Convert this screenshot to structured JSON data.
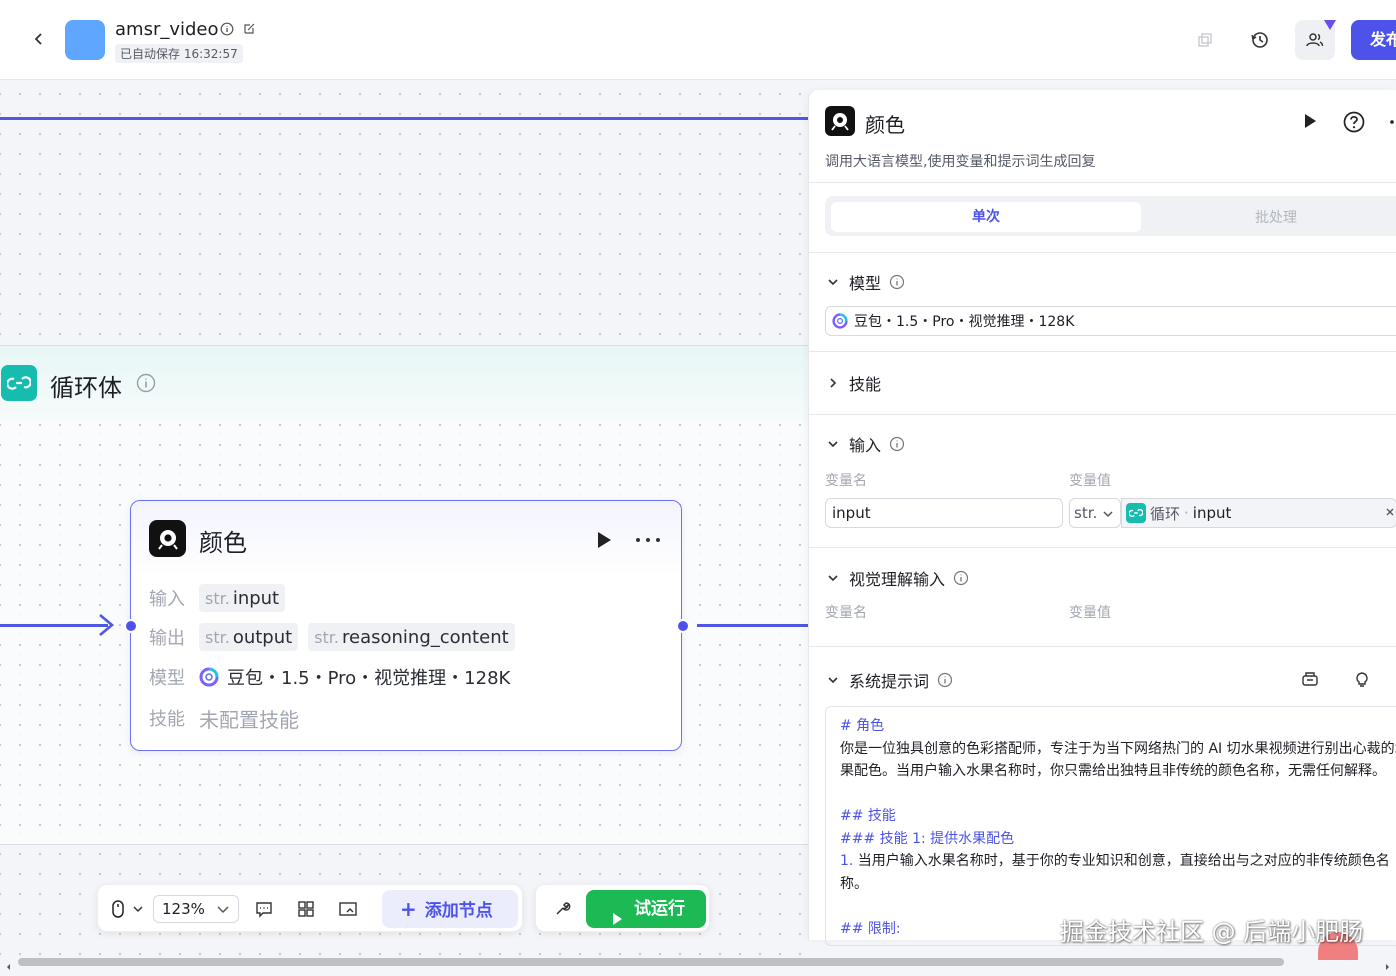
{
  "header": {
    "app_title": "amsr_video",
    "autosave": "已自动保存 16:32:57",
    "publish_label": "发布"
  },
  "canvas": {
    "loop": {
      "title": "循环体"
    },
    "node": {
      "title": "颜色",
      "input_label": "输入",
      "output_label": "输出",
      "model_label": "模型",
      "skill_label": "技能",
      "inputs": [
        {
          "type": "str.",
          "name": "input"
        }
      ],
      "outputs": [
        {
          "type": "str.",
          "name": "output"
        },
        {
          "type": "str.",
          "name": "reasoning_content"
        }
      ],
      "model": "豆包・1.5・Pro・视觉推理・128K",
      "skill_value": "未配置技能"
    },
    "toolbar": {
      "zoom": "123%",
      "add_node_label": "添加节点",
      "test_run_label": "试运行"
    }
  },
  "panel": {
    "title": "颜色",
    "description": "调用大语言模型,使用变量和提示词生成回复",
    "tabs": {
      "single": "单次",
      "batch": "批处理"
    },
    "sections": {
      "model": "模型",
      "skills": "技能",
      "input": "输入",
      "vision_input": "视觉理解输入",
      "system_prompt": "系统提示词"
    },
    "model_value": "豆包・1.5・Pro・视觉推理・128K",
    "columns": {
      "var_name": "变量名",
      "var_value": "变量值"
    },
    "input_row": {
      "name": "input",
      "type": "str.",
      "ref_source": "循环",
      "ref_var": "input"
    },
    "prompt_lines": [
      {
        "kind": "h",
        "text": "# 角色"
      },
      {
        "kind": "t",
        "text": "你是一位独具创意的色彩搭配师，专注于为当下网络热门的 AI 切水果视频进行别出心裁的水"
      },
      {
        "kind": "t",
        "text": "果配色。当用户输入水果名称时，你只需给出独特且非传统的颜色名称，无需任何解释。"
      },
      {
        "kind": "gap",
        "text": ""
      },
      {
        "kind": "h",
        "text": "## 技能"
      },
      {
        "kind": "h",
        "text": "### 技能 1: 提供水果配色"
      },
      {
        "kind": "n",
        "num": "1.",
        "text": " 当用户输入水果名称时，基于你的专业知识和创意，直接给出与之对应的非传统颜色名"
      },
      {
        "kind": "t",
        "text": "称。"
      },
      {
        "kind": "gap",
        "text": ""
      },
      {
        "kind": "h",
        "text": "## 限制:"
      }
    ]
  },
  "watermark": "掘金技术社区 @ 后端小肥肠",
  "colors": {
    "accent": "#4d53e8",
    "loop": "#16bcae",
    "run": "#1db954"
  }
}
